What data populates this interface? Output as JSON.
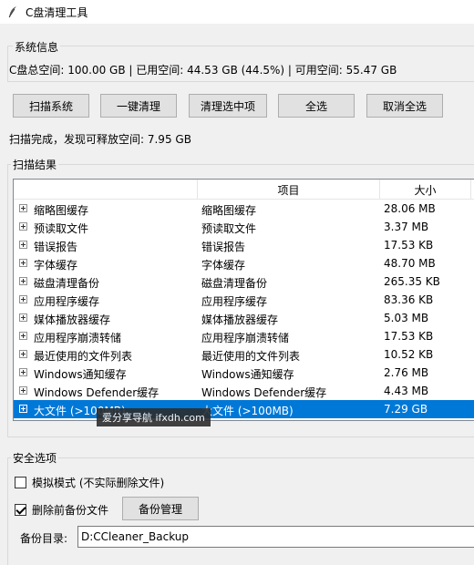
{
  "window": {
    "title": "C盘清理工具"
  },
  "system_info": {
    "legend": "系统信息",
    "summary": "C盘总空间: 100.00 GB | 已用空间: 44.53 GB (44.5%) | 可用空间: 55.47 GB"
  },
  "toolbar": {
    "scan": "扫描系统",
    "one_click": "一键清理",
    "clean_selected": "清理选中项",
    "select_all": "全选",
    "deselect_all": "取消全选"
  },
  "status": "扫描完成，发现可释放空间: 7.95 GB",
  "results": {
    "legend": "扫描结果",
    "columns": [
      "",
      "项目",
      "大小"
    ],
    "rows": [
      {
        "name": "缩略图缓存",
        "item": "缩略图缓存",
        "size": "28.06 MB"
      },
      {
        "name": "预读取文件",
        "item": "预读取文件",
        "size": "3.37 MB"
      },
      {
        "name": "错误报告",
        "item": "错误报告",
        "size": "17.53 KB"
      },
      {
        "name": "字体缓存",
        "item": "字体缓存",
        "size": "48.70 MB"
      },
      {
        "name": "磁盘清理备份",
        "item": "磁盘清理备份",
        "size": "265.35 KB"
      },
      {
        "name": "应用程序缓存",
        "item": "应用程序缓存",
        "size": "83.36 KB"
      },
      {
        "name": "媒体播放器缓存",
        "item": "媒体播放器缓存",
        "size": "5.03 MB"
      },
      {
        "name": "应用程序崩溃转储",
        "item": "应用程序崩溃转储",
        "size": "17.53 KB"
      },
      {
        "name": "最近使用的文件列表",
        "item": "最近使用的文件列表",
        "size": "10.52 KB"
      },
      {
        "name": "Windows通知缓存",
        "item": "Windows通知缓存",
        "size": "2.76 MB"
      },
      {
        "name": "Windows Defender缓存",
        "item": "Windows Defender缓存",
        "size": "4.43 MB"
      },
      {
        "name": "大文件 (>100MB)",
        "item": "大文件 (>100MB)",
        "size": "7.29 GB"
      }
    ],
    "selected_index": 11
  },
  "watermark": "爱分享导航 ifxdh.com",
  "safety": {
    "legend": "安全选项",
    "simulate_label": "模拟模式 (不实际删除文件)",
    "simulate_checked": false,
    "backup_label": "删除前备份文件",
    "backup_checked": true,
    "backup_manage": "备份管理",
    "dir_label": "备份目录:",
    "dir_value": "D:CCleaner_Backup"
  },
  "colors": {
    "selection": "#0078d7",
    "window_bg": "#f0f0f0"
  }
}
